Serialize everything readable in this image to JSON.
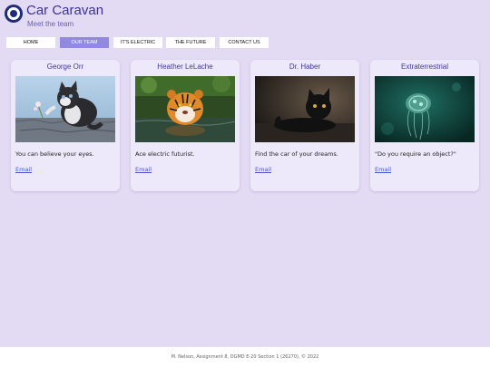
{
  "site": {
    "title": "Car Caravan",
    "subtitle": "Meet the team"
  },
  "nav": {
    "items": [
      {
        "label": "HOME"
      },
      {
        "label": "OUR TEAM"
      },
      {
        "label": "IT'S ELECTRIC"
      },
      {
        "label": "THE FUTURE"
      },
      {
        "label": "CONTACT US"
      }
    ],
    "active": "OUR TEAM"
  },
  "team": [
    {
      "name": "George Orr",
      "image": "kitten-with-flower",
      "quote": "You can believe your eyes.",
      "link": "Email"
    },
    {
      "name": "Heather LeLache",
      "image": "tiger-in-water",
      "quote": "Ace electric futurist.",
      "link": "Email"
    },
    {
      "name": "Dr. Haber",
      "image": "black-cat",
      "quote": "Find the car of your dreams.",
      "link": "Email"
    },
    {
      "name": "Extraterrestrial",
      "image": "jellyfish",
      "quote": "\"Do you require an object?\"",
      "link": "Email"
    }
  ],
  "footer": {
    "text": "M. Nelson, Assignment 8, DGMD E-20 Section 1 (26270), © 2022"
  },
  "colors": {
    "background": "#e3dbf3",
    "card": "#eee9fa",
    "accent": "#3d3199",
    "nav_active": "#9189e0",
    "link": "#4b56c8"
  }
}
